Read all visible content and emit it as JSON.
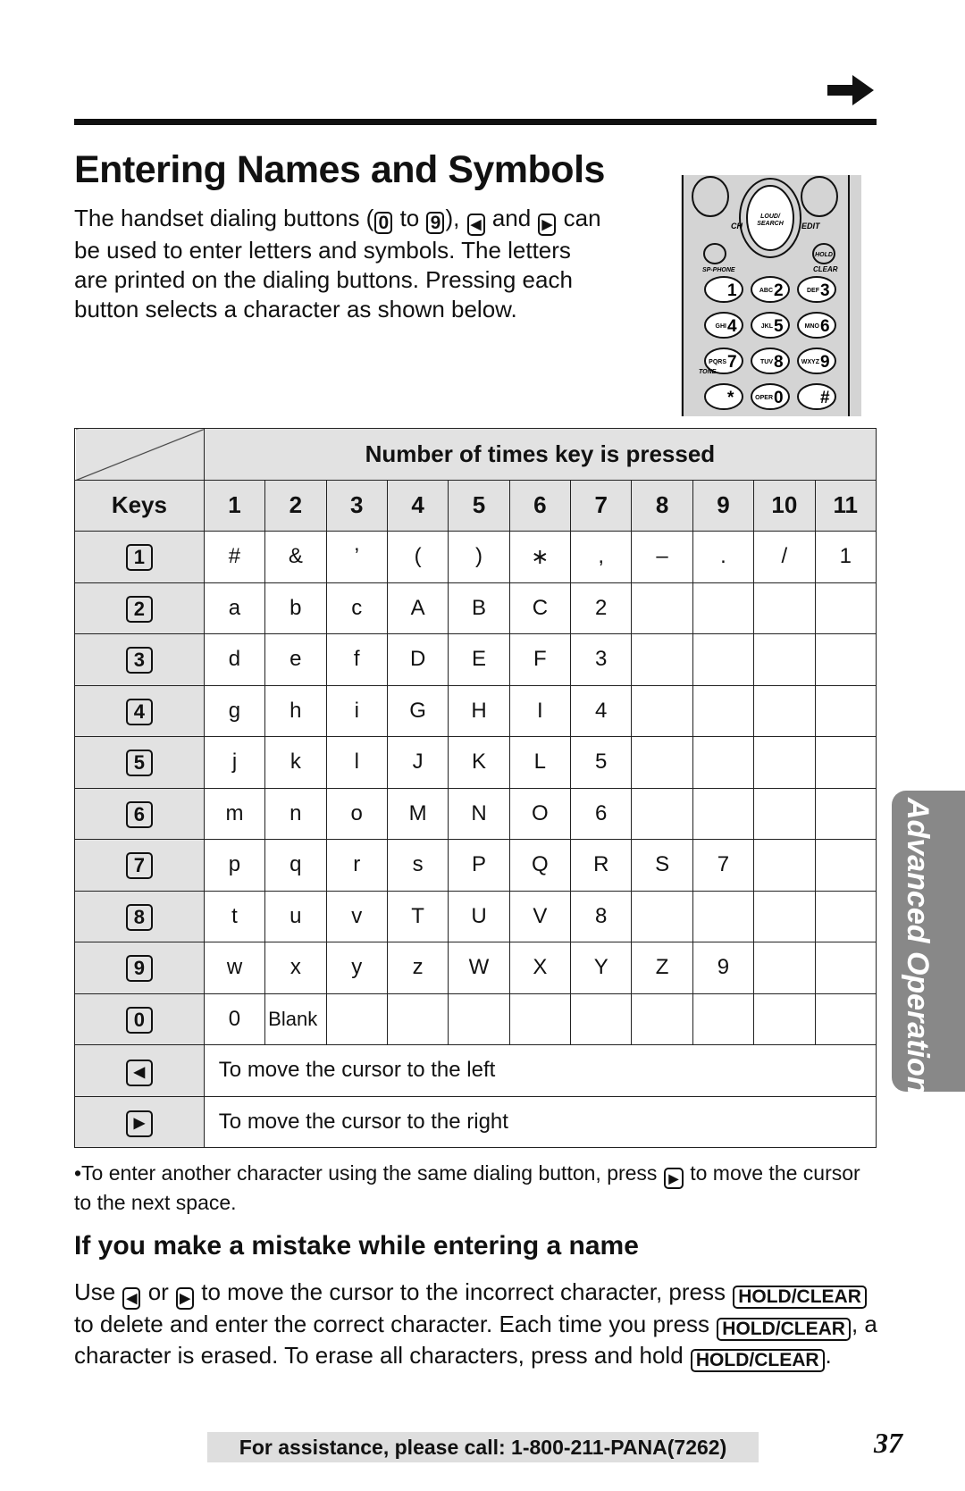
{
  "title": "Entering Names and Symbols",
  "intro": [
    {
      "t": "The handset dialing buttons ("
    },
    {
      "k": "0"
    },
    {
      "t": " to "
    },
    {
      "k": "9"
    },
    {
      "t": "), "
    },
    {
      "k": "◀",
      "tri": true
    },
    {
      "t": " and "
    },
    {
      "k": "▶",
      "tri": true
    },
    {
      "t": " can be used to enter letters and symbols. The letters are printed on the dialing buttons. Pressing each button selects a character as shown below."
    }
  ],
  "phone": {
    "labels": {
      "loud": "LOUD/",
      "search": "SEARCH",
      "ch": "CH",
      "edit": "EDIT",
      "hold": "HOLD",
      "clear": "CLEAR",
      "spphone": "SP-PHONE",
      "tone": "TONE"
    },
    "keys": [
      [
        "1",
        ""
      ],
      [
        "2",
        "ABC"
      ],
      [
        "3",
        "DEF"
      ],
      [
        "4",
        "GHI"
      ],
      [
        "5",
        "JKL"
      ],
      [
        "6",
        "MNO"
      ],
      [
        "7",
        "PQRS"
      ],
      [
        "8",
        "TUV"
      ],
      [
        "9",
        "WXYZ"
      ],
      [
        "*",
        ""
      ],
      [
        "0",
        "OPER"
      ],
      [
        "#",
        ""
      ]
    ]
  },
  "table": {
    "header": "Number of times key is pressed",
    "keys_label": "Keys",
    "columns": [
      "1",
      "2",
      "3",
      "4",
      "5",
      "6",
      "7",
      "8",
      "9",
      "10",
      "11"
    ],
    "rows": [
      {
        "key": "1",
        "cells": [
          "#",
          "&",
          "’",
          "(",
          ")",
          "∗",
          ",",
          "–",
          ".",
          "/",
          "1"
        ]
      },
      {
        "key": "2",
        "cells": [
          "a",
          "b",
          "c",
          "A",
          "B",
          "C",
          "2",
          "",
          "",
          "",
          ""
        ]
      },
      {
        "key": "3",
        "cells": [
          "d",
          "e",
          "f",
          "D",
          "E",
          "F",
          "3",
          "",
          "",
          "",
          ""
        ]
      },
      {
        "key": "4",
        "cells": [
          "g",
          "h",
          "i",
          "G",
          "H",
          "I",
          "4",
          "",
          "",
          "",
          ""
        ]
      },
      {
        "key": "5",
        "cells": [
          "j",
          "k",
          "l",
          "J",
          "K",
          "L",
          "5",
          "",
          "",
          "",
          ""
        ]
      },
      {
        "key": "6",
        "cells": [
          "m",
          "n",
          "o",
          "M",
          "N",
          "O",
          "6",
          "",
          "",
          "",
          ""
        ]
      },
      {
        "key": "7",
        "cells": [
          "p",
          "q",
          "r",
          "s",
          "P",
          "Q",
          "R",
          "S",
          "7",
          "",
          ""
        ]
      },
      {
        "key": "8",
        "cells": [
          "t",
          "u",
          "v",
          "T",
          "U",
          "V",
          "8",
          "",
          "",
          "",
          ""
        ]
      },
      {
        "key": "9",
        "cells": [
          "w",
          "x",
          "y",
          "z",
          "W",
          "X",
          "Y",
          "Z",
          "9",
          "",
          ""
        ]
      },
      {
        "key": "0",
        "cells": [
          "0",
          "Blank",
          "",
          "",
          "",
          "",
          "",
          "",
          "",
          "",
          ""
        ]
      }
    ],
    "cursor_rows": [
      {
        "key": "◀",
        "text": "To move the cursor to the left"
      },
      {
        "key": "▶",
        "text": "To move the cursor to the right"
      }
    ]
  },
  "note": [
    {
      "t": "•To enter another character using the same dialing button, press "
    },
    {
      "k": "▶",
      "tri": true
    },
    {
      "t": " to move the cursor to the next space."
    }
  ],
  "mistake_heading": "If you make a mistake while entering a name",
  "mistake_text": [
    {
      "t": "Use "
    },
    {
      "k": "◀",
      "tri": true
    },
    {
      "t": " or "
    },
    {
      "k": "▶",
      "tri": true
    },
    {
      "t": " to move the cursor to the incorrect character, press "
    },
    {
      "k": "HOLD/CLEAR",
      "word": true
    },
    {
      "t": " to delete and enter the correct character. Each time you press "
    },
    {
      "k": "HOLD/CLEAR",
      "word": true
    },
    {
      "t": ", a character is erased. To erase all characters, press and hold "
    },
    {
      "k": "HOLD/CLEAR",
      "word": true
    },
    {
      "t": "."
    }
  ],
  "footer": "For assistance, please call: 1-800-211-PANA(7262)",
  "page_number": "37",
  "side_tab": "Advanced Operation",
  "colors": {
    "table_shade": "#e2e2e2",
    "side_tab": "#888888",
    "footer_bg": "#dedede"
  }
}
